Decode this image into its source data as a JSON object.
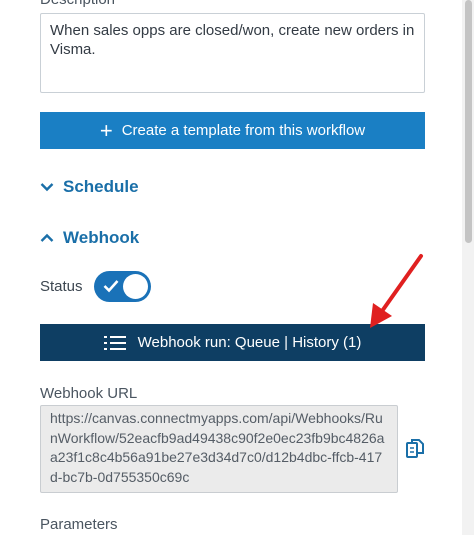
{
  "description": {
    "label": "Description",
    "value": "When sales opps are closed/won, create new orders in Visma."
  },
  "template_button": {
    "icon": "plus-icon",
    "label": "Create a template from this workflow"
  },
  "schedule": {
    "label": "Schedule",
    "icon": "chevron-down-icon",
    "expanded": false
  },
  "webhook": {
    "label": "Webhook",
    "icon": "chevron-up-icon",
    "expanded": true
  },
  "status": {
    "label": "Status",
    "enabled": true
  },
  "run_button": {
    "icon": "list-icon",
    "label": "Webhook run: Queue | History (1)"
  },
  "webhook_url": {
    "label": "Webhook URL",
    "value": "https://canvas.connectmyapps.com/api/Webhooks/RunWorkflow/52eacfb9ad49438c90f2e0ec23fb9bc4826aa23f1c8c4b56a91be27e3d34d7c0/d12b4dbc-ffcb-417d-bc7b-0d755350c69c"
  },
  "parameters": {
    "label": "Parameters"
  },
  "colors": {
    "primary_button": "#1a7fc4",
    "dark_button": "#0e3e63",
    "link": "#1a6fa8",
    "annotation_arrow": "#e02020"
  }
}
